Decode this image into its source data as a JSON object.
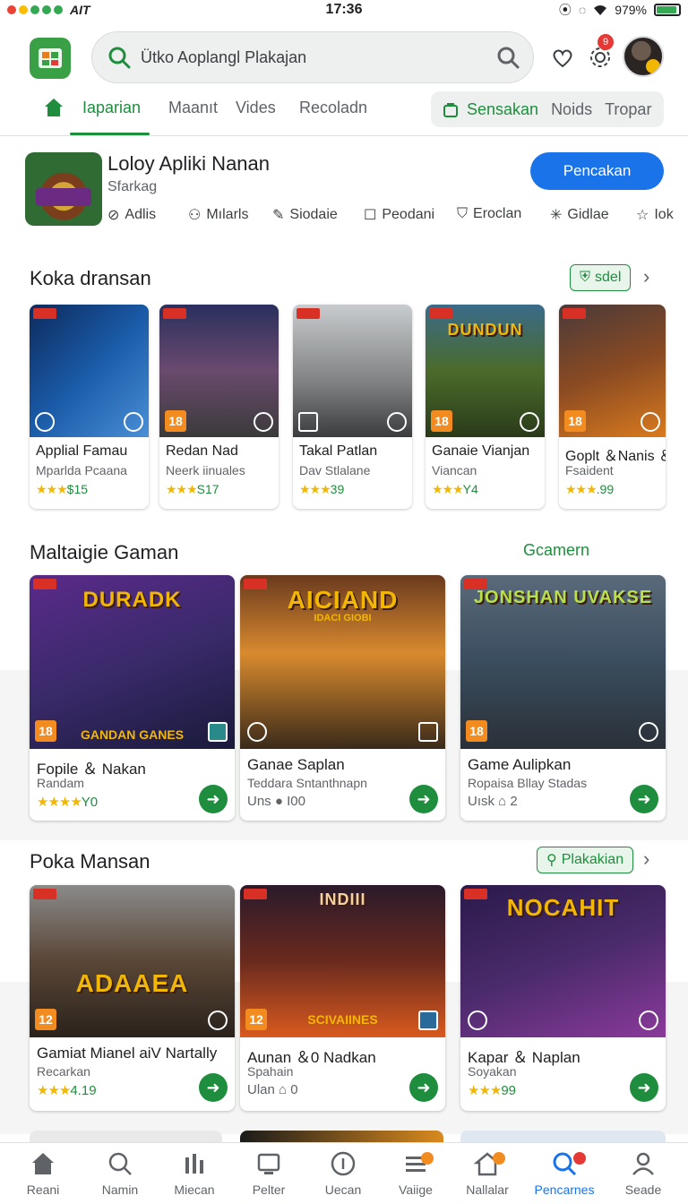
{
  "status_bar": {
    "carrier": "AIT",
    "time": "17:36",
    "battery": "979%"
  },
  "header": {
    "search_placeholder": "Ütko Aoplangl Plakajan",
    "notification_count": "9"
  },
  "tabs": [
    {
      "label": "Iaparian",
      "active": true
    },
    {
      "label": "Maanıt"
    },
    {
      "label": "Vides"
    },
    {
      "label": "Recoladn"
    }
  ],
  "chips": [
    {
      "label": "Sensakan",
      "active": true
    },
    {
      "label": "Noids"
    },
    {
      "label": "Tropar"
    }
  ],
  "featured": {
    "title": "Loloy Apliki Nanan",
    "subtitle": "Sfarkag",
    "button": "Pencakan",
    "meta": [
      "Adlis",
      "Mılarls",
      "Siodaie",
      "Peodani",
      "Eroclan",
      "Gidlae",
      "Iok"
    ]
  },
  "section1": {
    "title": "Koka dransan",
    "pill": "sdel",
    "cards": [
      {
        "title": "Applial Famau",
        "desc": "Mparlda Pcaana",
        "rating": "$15",
        "badge": "",
        "bg": "#1a4d8c"
      },
      {
        "title": "Redan Nad",
        "desc": "Neerk iinuales",
        "rating": "S17",
        "badge": "18",
        "bg": "#3b3f6e"
      },
      {
        "title": "Takal Patlan",
        "desc": "Dav Stlalane",
        "rating": "39",
        "badge": "",
        "bg": "#7d7f80"
      },
      {
        "title": "Ganaie Vianjan",
        "desc": "Viancan",
        "rating": "Y4",
        "badge": "18",
        "bg": "#4b6b2a",
        "art_title": "DUNDUN"
      },
      {
        "title": "Goplt ＆Nanis ＆",
        "desc": "Fsaident",
        "rating": ".99",
        "badge": "18",
        "bg": "#8a4a22"
      }
    ]
  },
  "section2": {
    "title": "Maltaigie Gaman",
    "link": "Gcamern",
    "cards": [
      {
        "title": "Fopile ＆ Nakan",
        "desc": "Randam",
        "rating": "Y0",
        "badge": "18",
        "bg": "#3a2a6b",
        "art_title": "DURADK",
        "art_sub": "GANDAN GANES"
      },
      {
        "title": "Ganae Saplan",
        "desc": "Teddara Sntanthnapn",
        "rating": "Uns ● I00",
        "badge": "",
        "bg": "#8a5a1e",
        "art_title": "AICIAND",
        "art_sub": "IDACI GIOBI"
      },
      {
        "title": "Game Aulipkan",
        "desc": "Ropaisa Bllay Stadas",
        "rating": "Uısk ⌂ 2",
        "badge": "18",
        "bg": "#3a4d5e",
        "art_title": "JONSHAN UVAKSE",
        "art_sub": ""
      }
    ]
  },
  "section3": {
    "title": "Poka Mansan",
    "pill": "Plakakian",
    "cards": [
      {
        "title": "Gamiat Mianel aiV Nartally",
        "desc": "Recarkan",
        "rating": "4.19",
        "badge": "12",
        "bg": "#5a4636",
        "art_title": "ADAAEA",
        "art_sub": ""
      },
      {
        "title": "Aunan ＆0 Nadkan",
        "desc": "Spahain",
        "rating": "Ulan ⌂ 0",
        "badge": "12",
        "bg": "#6a2a1e",
        "art_title": "INDIII",
        "art_sub": "SCIVAIINES"
      },
      {
        "title": "Kapar ＆ Naplan",
        "desc": "Soyakan",
        "rating": "99",
        "badge": "",
        "bg": "#4a2a6b",
        "art_title": "NOCAHIT",
        "art_sub": ""
      }
    ]
  },
  "bottom_nav": [
    {
      "label": "Reani"
    },
    {
      "label": "Namin"
    },
    {
      "label": "Miecan"
    },
    {
      "label": "Pelter"
    },
    {
      "label": "Uecan"
    },
    {
      "label": "Vaiige"
    },
    {
      "label": "Nallalar"
    },
    {
      "label": "Pencarnes",
      "active": true
    },
    {
      "label": "Seade"
    }
  ],
  "colors": {
    "accent": "#1e8e3e",
    "primary_button": "#1a73e8",
    "badge18": "#f28b20"
  }
}
